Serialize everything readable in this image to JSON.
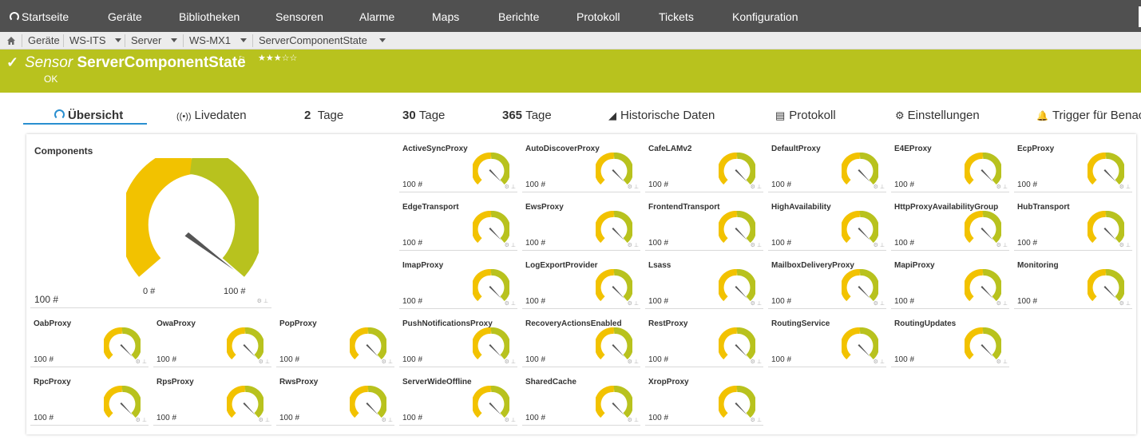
{
  "nav": {
    "items": [
      "Startseite",
      "Geräte",
      "Bibliotheken",
      "Sensoren",
      "Alarme",
      "Maps",
      "Berichte",
      "Protokoll",
      "Tickets",
      "Konfiguration"
    ]
  },
  "breadcrumb": [
    "Geräte",
    "WS-ITS",
    "Server",
    "WS-MX1",
    "ServerComponentState"
  ],
  "sensor": {
    "prefix": "Sensor",
    "name": "ServerComponentState",
    "stars": "★★★☆☆",
    "status": "OK"
  },
  "tabs": [
    {
      "num": "",
      "label": "Übersicht"
    },
    {
      "num": "",
      "label": "Livedaten"
    },
    {
      "num": "2",
      "label": "Tage"
    },
    {
      "num": "30",
      "label": "Tage"
    },
    {
      "num": "365",
      "label": "Tage"
    },
    {
      "num": "",
      "label": "Historische Daten"
    },
    {
      "num": "",
      "label": "Protokoll"
    },
    {
      "num": "",
      "label": "Einstellungen"
    },
    {
      "num": "",
      "label": "Trigger für Benac"
    }
  ],
  "components": {
    "label": "Components",
    "value": "100 #",
    "min": "0 #",
    "max": "100 #"
  },
  "channels": [
    {
      "name": "ActiveSyncProxy",
      "value": "100 #"
    },
    {
      "name": "AutoDiscoverProxy",
      "value": "100 #"
    },
    {
      "name": "CafeLAMv2",
      "value": "100 #"
    },
    {
      "name": "DefaultProxy",
      "value": "100 #"
    },
    {
      "name": "E4EProxy",
      "value": "100 #"
    },
    {
      "name": "EcpProxy",
      "value": "100 #"
    },
    {
      "name": "EdgeTransport",
      "value": "100 #"
    },
    {
      "name": "EwsProxy",
      "value": "100 #"
    },
    {
      "name": "FrontendTransport",
      "value": "100 #"
    },
    {
      "name": "HighAvailability",
      "value": "100 #"
    },
    {
      "name": "HttpProxyAvailabilityGroup",
      "value": "100 #"
    },
    {
      "name": "HubTransport",
      "value": "100 #"
    },
    {
      "name": "ImapProxy",
      "value": "100 #"
    },
    {
      "name": "LogExportProvider",
      "value": "100 #"
    },
    {
      "name": "Lsass",
      "value": "100 #"
    },
    {
      "name": "MailboxDeliveryProxy",
      "value": "100 #"
    },
    {
      "name": "MapiProxy",
      "value": "100 #"
    },
    {
      "name": "Monitoring",
      "value": "100 #"
    },
    {
      "name": "OabProxy",
      "value": "100 #"
    },
    {
      "name": "OwaProxy",
      "value": "100 #"
    },
    {
      "name": "PopProxy",
      "value": "100 #"
    },
    {
      "name": "PushNotificationsProxy",
      "value": "100 #"
    },
    {
      "name": "RecoveryActionsEnabled",
      "value": "100 #"
    },
    {
      "name": "RestProxy",
      "value": "100 #"
    },
    {
      "name": "RoutingService",
      "value": "100 #"
    },
    {
      "name": "RoutingUpdates",
      "value": "100 #"
    },
    {
      "name": "RpcProxy",
      "value": "100 #"
    },
    {
      "name": "RpsProxy",
      "value": "100 #"
    },
    {
      "name": "RwsProxy",
      "value": "100 #"
    },
    {
      "name": "ServerWideOffline",
      "value": "100 #"
    },
    {
      "name": "SharedCache",
      "value": "100 #"
    },
    {
      "name": "XropProxy",
      "value": "100 #"
    }
  ],
  "colors": {
    "banner": "#b8c21e",
    "gauge_yellow": "#f2c200",
    "gauge_green": "#b8c21e",
    "nav": "#505050",
    "active_tab": "#2a8fd0"
  }
}
